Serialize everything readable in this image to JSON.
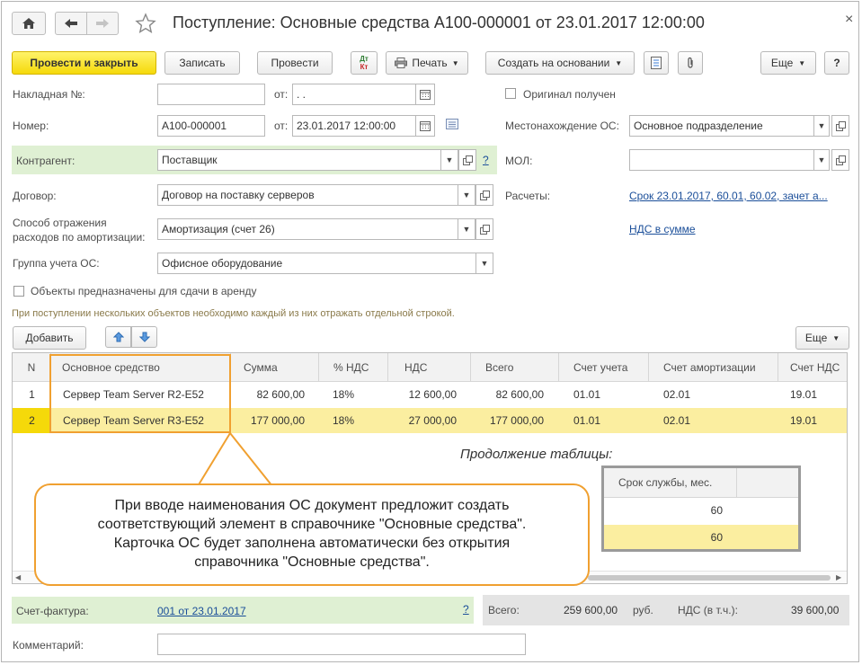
{
  "window": {
    "title": "Поступление: Основные средства А100-000001 от 23.01.2017 12:00:00",
    "close_glyph": "×"
  },
  "toolbar": {
    "post_close": "Провести и закрыть",
    "save": "Записать",
    "post": "Провести",
    "dt_kt_top": "Дт",
    "dt_kt_bottom": "Кт",
    "print": "Печать",
    "create_based": "Создать на основании",
    "more": "Еще",
    "help": "?"
  },
  "form": {
    "invoice_no_label": "Накладная №:",
    "invoice_no_value": "",
    "invoice_from_label": "от:",
    "invoice_from_value": " .  .",
    "original_label": "Оригинал получен",
    "number_label": "Номер:",
    "number_value": "А100-000001",
    "number_from_label": "от:",
    "number_from_value": "23.01.2017 12:00:00",
    "location_label": "Местонахождение ОС:",
    "location_value": "Основное подразделение",
    "counterparty_label": "Контрагент:",
    "counterparty_value": "Поставщик",
    "counterparty_help": "?",
    "mol_label": "МОЛ:",
    "mol_value": "",
    "contract_label": "Договор:",
    "contract_value": "Договор на поставку серверов",
    "settlements_label": "Расчеты:",
    "settlements_link": "Срок 23.01.2017, 60.01, 60.02, зачет а...",
    "amort_label_1": "Способ отражения",
    "amort_label_2": "расходов по амортизации:",
    "amort_value": "Амортизация (счет 26)",
    "vat_link": "НДС в сумме",
    "group_label": "Группа учета ОС:",
    "group_value": "Офисное оборудование",
    "lease_label": "Объекты предназначены для сдачи в аренду",
    "hint": "При поступлении нескольких объектов необходимо каждый из них отражать отдельной строкой."
  },
  "table_toolbar": {
    "add": "Добавить",
    "more": "Еще"
  },
  "table": {
    "columns": [
      "N",
      "Основное средство",
      "Сумма",
      "% НДС",
      "НДС",
      "Всего",
      "Счет учета",
      "Счет амортизации",
      "Счет НДС"
    ],
    "rows": [
      [
        "1",
        "Сервер Team Server R2-E52",
        "82 600,00",
        "18%",
        "12 600,00",
        "82 600,00",
        "01.01",
        "02.01",
        "19.01"
      ],
      [
        "2",
        "Сервер Team Server R3-E52",
        "177 000,00",
        "18%",
        "27 000,00",
        "177 000,00",
        "01.01",
        "02.01",
        "19.01"
      ]
    ]
  },
  "continuation": {
    "caption": "Продолжение таблицы:",
    "column": "Срок службы, мес.",
    "rows": [
      "60",
      "60"
    ]
  },
  "callout": {
    "line1": "При вводе наименования ОС документ предложит создать",
    "line2": "соответствующий элемент в справочнике \"Основные средства\".",
    "line3": "Карточка ОС будет заполнена автоматически без открытия",
    "line4": "справочника \"Основные средства\"."
  },
  "footer": {
    "invoice_label": "Счет-фактура:",
    "invoice_link": "001 от 23.01.2017",
    "invoice_help": "?",
    "total_label": "Всего:",
    "total_value": "259 600,00",
    "currency": "руб.",
    "vat_label": "НДС (в т.ч.):",
    "vat_value": "39 600,00",
    "comment_label": "Комментарий:",
    "comment_value": ""
  },
  "colors": {
    "accent_yellow": "#f5d90a",
    "highlight_green": "#dff0d3",
    "selected_row": "#fbeea0",
    "callout_border": "#f0a030",
    "link": "#1a4e99"
  }
}
